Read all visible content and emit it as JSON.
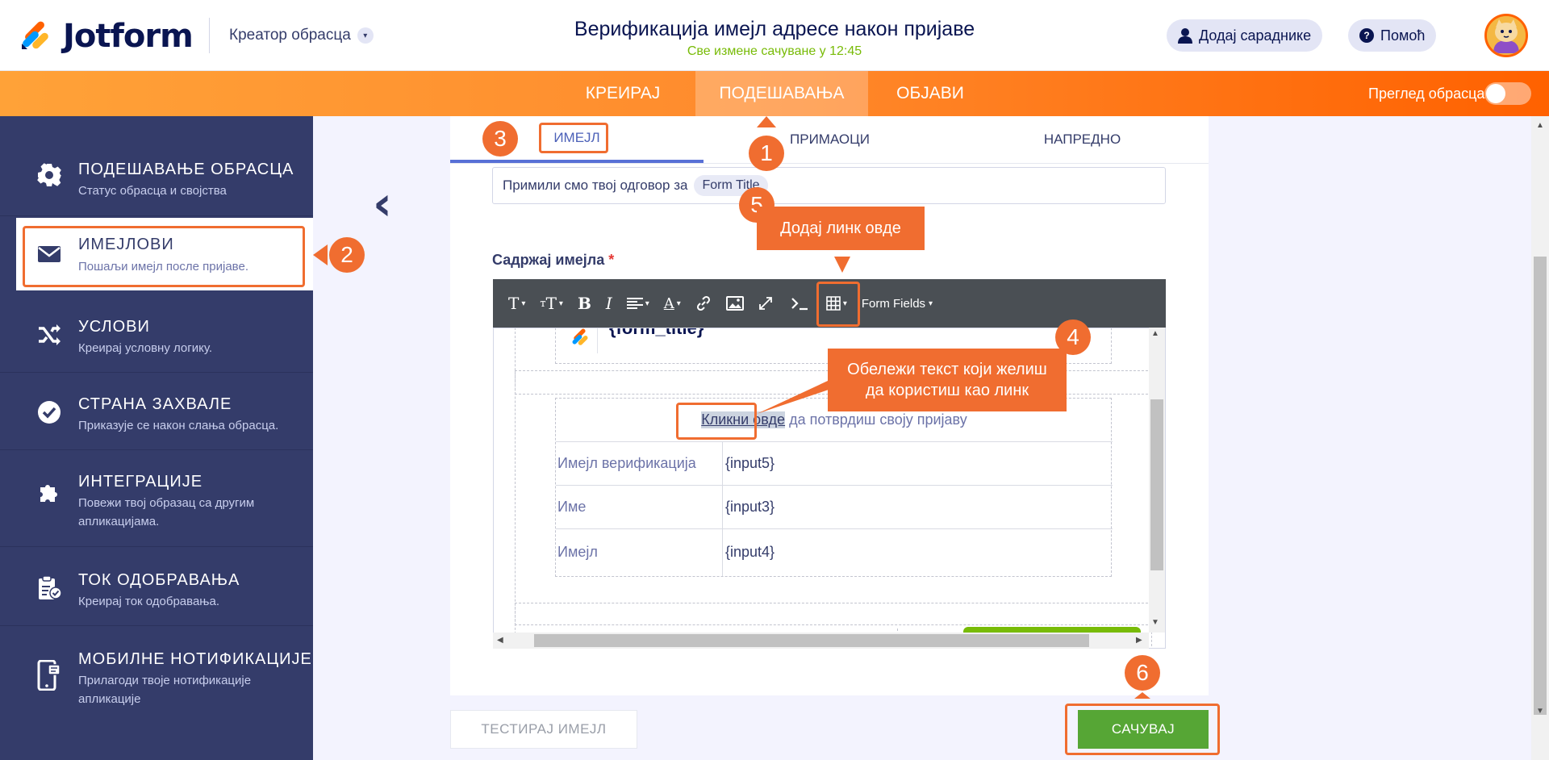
{
  "header": {
    "logo_text": "Jotform",
    "creator_label": "Креатор обрасца",
    "form_title": "Верификација имејл адресе након пријаве",
    "saved_status": "Све измене сачуване у 12:45",
    "add_collaborators": "Додај сараднике",
    "help": "Помоћ"
  },
  "nav": {
    "tabs": [
      "КРЕИРАЈ",
      "ПОДЕШАВАЊА",
      "ОБЈАВИ"
    ],
    "active": "ПОДЕШАВАЊА",
    "preview_label": "Преглед обрасца"
  },
  "sidebar": {
    "items": [
      {
        "title": "ПОДЕШАВАЊЕ ОБРАСЦА",
        "subtitle": "Статус обрасца и својства",
        "icon": "gear-icon"
      },
      {
        "title": "ИМЕЈЛОВИ",
        "subtitle": "Пошаљи имејл после пријаве.",
        "icon": "envelope-icon"
      },
      {
        "title": "УСЛОВИ",
        "subtitle": "Креирај условну логику.",
        "icon": "shuffle-icon"
      },
      {
        "title": "СТРАНА ЗАХВАЛЕ",
        "subtitle": "Приказује се након слања обрасца.",
        "icon": "check-circle-icon"
      },
      {
        "title": "ИНТЕГРАЦИЈЕ",
        "subtitle": "Повежи твој образац са другим апликацијама.",
        "icon": "puzzle-icon"
      },
      {
        "title": "ТОК ОДОБРАВАЊА",
        "subtitle": "Креирај ток одобравања.",
        "icon": "approval-icon"
      },
      {
        "title": "МОБИЛНЕ НОТИФИКАЦИЈЕ",
        "subtitle": "Прилагоди твоје нотификације апликације",
        "icon": "mobile-icon"
      }
    ]
  },
  "email_tabs": [
    "ИМЕЈЛ",
    "ПРИМАОЦИ",
    "НАПРЕДНО"
  ],
  "subject": {
    "text": "Примили смо твој одговор за",
    "pill": "Form Title"
  },
  "content_label": "Садржај имејла",
  "required_mark": "*",
  "toolbar": {
    "form_fields": "Form Fields"
  },
  "editor": {
    "form_title_var": "{form_title}",
    "link_text": "Кликни овде",
    "link_rest": " да потврдиш своју пријаву",
    "rows": [
      {
        "label": "Имејл верификација",
        "value": "{input5}"
      },
      {
        "label": "Име",
        "value": "{input3}"
      },
      {
        "label": "Имејл",
        "value": "{input4}"
      }
    ]
  },
  "buttons": {
    "test_email": "ТЕСТИРАЈ ИМЕЈЛ",
    "save": "САЧУВАЈ"
  },
  "annotations": {
    "badges": [
      "1",
      "2",
      "3",
      "4",
      "5",
      "6"
    ],
    "tip_link": "Додај линк овде",
    "tip_select": "Обележи текст који желиш да користиш као линк"
  },
  "colors": {
    "accent": "#f06d30",
    "nav_gradient_start": "#ffa238",
    "nav_gradient_end": "#ff6100",
    "sidebar": "#343c6a",
    "save_green": "#56a635",
    "saved_text": "#78bb07"
  }
}
